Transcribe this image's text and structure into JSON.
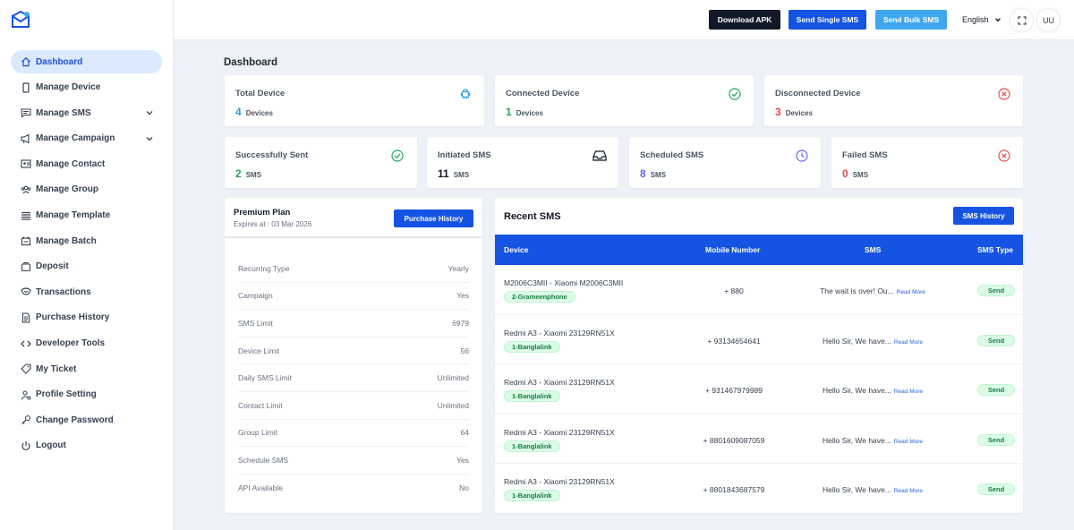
{
  "sidebar": {
    "items": [
      {
        "label": "Dashboard",
        "icon": "home-icon",
        "active": true
      },
      {
        "label": "Manage Device",
        "icon": "device-icon"
      },
      {
        "label": "Manage SMS",
        "icon": "message-icon",
        "expandable": true
      },
      {
        "label": "Manage Campaign",
        "icon": "campaign-icon",
        "expandable": true
      },
      {
        "label": "Manage Contact",
        "icon": "contact-icon"
      },
      {
        "label": "Manage Group",
        "icon": "group-icon"
      },
      {
        "label": "Manage Template",
        "icon": "template-icon"
      },
      {
        "label": "Manage Batch",
        "icon": "batch-icon"
      },
      {
        "label": "Deposit",
        "icon": "wallet-icon"
      },
      {
        "label": "Transactions",
        "icon": "transactions-icon"
      },
      {
        "label": "Purchase History",
        "icon": "document-icon"
      },
      {
        "label": "Developer Tools",
        "icon": "code-icon"
      },
      {
        "label": "My Ticket",
        "icon": "ticket-icon"
      },
      {
        "label": "Profile Setting",
        "icon": "user-cog-icon"
      },
      {
        "label": "Change Password",
        "icon": "key-icon"
      },
      {
        "label": "Logout",
        "icon": "power-icon"
      }
    ]
  },
  "topbar": {
    "download_apk": "Download APK",
    "send_single": "Send Single SMS",
    "send_bulk": "Send Bulk SMS",
    "language": "English",
    "avatar": "UU"
  },
  "page_title": "Dashboard",
  "stats_row1": [
    {
      "title": "Total Device",
      "value": "4",
      "unit": "Devices",
      "color": "#2b9fd9",
      "icon": "android-icon"
    },
    {
      "title": "Connected Device",
      "value": "1",
      "unit": "Devices",
      "color": "#22a55a",
      "icon": "check-circle-icon"
    },
    {
      "title": "Disconnected Device",
      "value": "3",
      "unit": "Devices",
      "color": "#e24d4d",
      "icon": "x-circle-icon"
    }
  ],
  "stats_row2": [
    {
      "title": "Successfully Sent",
      "value": "2",
      "unit": "SMS",
      "color": "#22a55a",
      "icon": "check-circle-icon"
    },
    {
      "title": "Initiated SMS",
      "value": "11",
      "unit": "SMS",
      "color": "#111827",
      "icon": "inbox-icon"
    },
    {
      "title": "Scheduled SMS",
      "value": "8",
      "unit": "SMS",
      "color": "#6366f1",
      "icon": "clock-icon"
    },
    {
      "title": "Failed SMS",
      "value": "0",
      "unit": "SMS",
      "color": "#e24d4d",
      "icon": "x-circle-icon"
    }
  ],
  "plan": {
    "title": "Premium Plan",
    "expires": "Expires at : 03 Mar 2026",
    "button": "Purchase History",
    "rows": [
      {
        "label": "Recurring Type",
        "value": "Yearly"
      },
      {
        "label": "Campaign",
        "value": "Yes"
      },
      {
        "label": "SMS Limit",
        "value": "6979"
      },
      {
        "label": "Device Limit",
        "value": "56"
      },
      {
        "label": "Daily SMS Limit",
        "value": "Unlimited"
      },
      {
        "label": "Contact Limit",
        "value": "Unlimited"
      },
      {
        "label": "Group Limit",
        "value": "64"
      },
      {
        "label": "Schedule SMS",
        "value": "Yes"
      },
      {
        "label": "API Available",
        "value": "No"
      }
    ]
  },
  "recent_sms": {
    "title": "Recent SMS",
    "button": "SMS History",
    "columns": [
      "Device",
      "Mobile Number",
      "SMS",
      "SMS Type"
    ],
    "rows": [
      {
        "device": "M2006C3MII - Xiaomi M2006C3MII",
        "operator": "2-Grameenphone",
        "mobile": "+ 880",
        "sms": "The wait is over! Ou...",
        "more": "Read More",
        "type": "Send"
      },
      {
        "device": "Redmi A3 - Xiaomi 23129RN51X",
        "operator": "1-Banglalink",
        "mobile": "+ 93134654641",
        "sms": "Hello Sir, We have...",
        "more": "Read More",
        "type": "Send"
      },
      {
        "device": "Redmi A3 - Xiaomi 23129RN51X",
        "operator": "1-Banglalink",
        "mobile": "+ 931467979989",
        "sms": "Hello Sir, We have...",
        "more": "Read More",
        "type": "Send"
      },
      {
        "device": "Redmi A3 - Xiaomi 23129RN51X",
        "operator": "1-Banglalink",
        "mobile": "+ 8801609087059",
        "sms": "Hello Sir, We have...",
        "more": "Read More",
        "type": "Send"
      },
      {
        "device": "Redmi A3 - Xiaomi 23129RN51X",
        "operator": "1-Banglalink",
        "mobile": "+ 8801843687579",
        "sms": "Hello Sir, We have...",
        "more": "Read More",
        "type": "Send"
      }
    ]
  },
  "colors": {
    "primary": "#1554e2",
    "accent": "#3fa7ee",
    "success": "#22a55a",
    "danger": "#e24d4d"
  }
}
